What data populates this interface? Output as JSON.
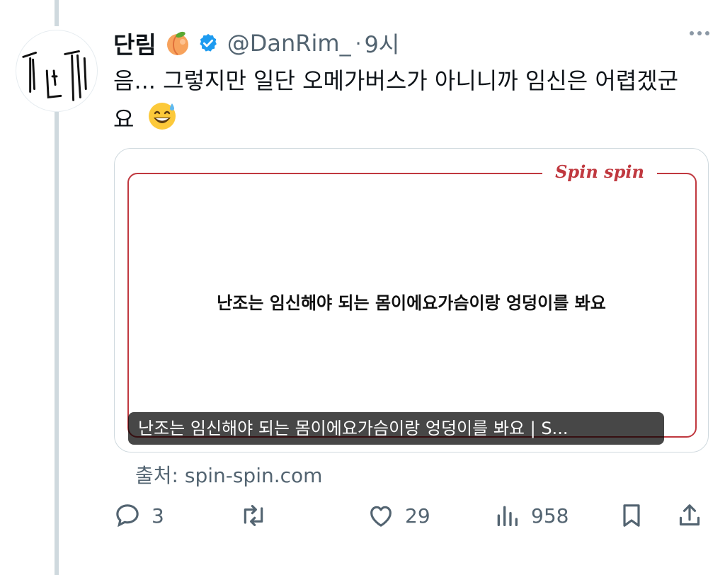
{
  "author": {
    "name": "단림",
    "handle": "@DanRim_",
    "time": "9시"
  },
  "tweet": {
    "text": "음... 그렇지만 일단 오메가버스가 아니니까 임신은 어렵겠군요"
  },
  "card": {
    "brand": "Spin spin",
    "headline": "난조는 임신해야 되는 몸이에요가슴이랑 엉덩이를 봐요",
    "caption": "난조는 임신해야 되는 몸이에요가슴이랑 엉덩이를 봐요 | S..."
  },
  "source": {
    "text": "출처: spin-spin.com"
  },
  "actions": {
    "replies": "3",
    "likes": "29",
    "views": "958"
  },
  "colors": {
    "brand_red": "#c0383f",
    "verified_blue": "#1d9bf0",
    "muted": "#536471"
  },
  "icons": [
    "peach-emoji",
    "verified-badge-icon",
    "more-icon",
    "sweat-smile-emoji",
    "reply-icon",
    "retweet-icon",
    "like-icon",
    "views-icon",
    "bookmark-icon",
    "share-icon"
  ]
}
